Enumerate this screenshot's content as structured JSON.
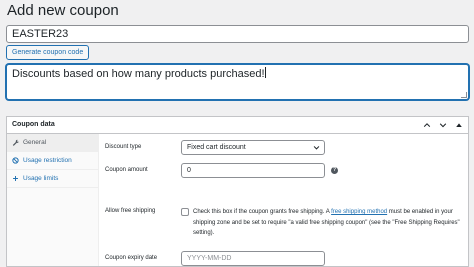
{
  "page": {
    "title": "Add new coupon"
  },
  "coupon": {
    "code": "EASTER23",
    "generate_label": "Generate coupon code",
    "description": "Discounts based on how many products purchased!"
  },
  "panel": {
    "title": "Coupon data",
    "controls": [
      "chevron-up-icon",
      "chevron-down-icon",
      "triangle-up-icon"
    ],
    "tabs": [
      {
        "label": "General",
        "icon": "wrench-icon",
        "active": true
      },
      {
        "label": "Usage restriction",
        "icon": "block-icon",
        "active": false
      },
      {
        "label": "Usage limits",
        "icon": "plus-icon",
        "active": false
      }
    ],
    "fields": {
      "discount_type": {
        "label": "Discount type",
        "value": "Fixed cart discount"
      },
      "coupon_amount": {
        "label": "Coupon amount",
        "value": "0"
      },
      "free_shipping": {
        "label": "Allow free shipping",
        "desc_before": "Check this box if the coupon grants free shipping. A ",
        "desc_link": "free shipping method",
        "desc_after": " must be enabled in your shipping zone and be set to require \"a valid free shipping coupon\" (see the \"Free Shipping Requires\" setting).",
        "checked": false
      },
      "expiry_date": {
        "label": "Coupon expiry date",
        "placeholder": "YYYY-MM-DD"
      }
    }
  },
  "colors": {
    "accent": "#2271b1",
    "text": "#1d2327",
    "background": "#f0f0f1"
  }
}
